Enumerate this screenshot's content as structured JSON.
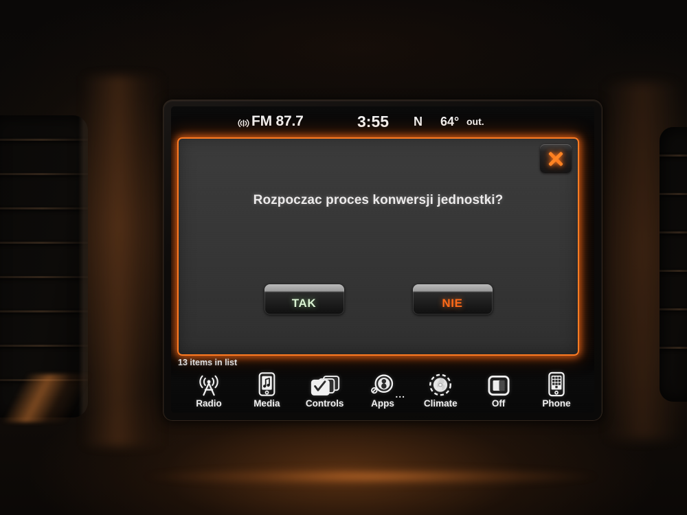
{
  "status_bar": {
    "source_icon": "broadcast-icon",
    "band": "FM 87.7",
    "clock": "3:55",
    "gear": "N",
    "temperature": "64°",
    "temperature_suffix": "out."
  },
  "dialog": {
    "message": "Rozpoczac proces konwersji jednostki?",
    "close_icon": "close-x-icon",
    "buttons": [
      {
        "label": "TAK",
        "role": "confirm",
        "color": "#d9f2d2"
      },
      {
        "label": "NIE",
        "role": "cancel",
        "color": "#ff6a18"
      }
    ]
  },
  "list_status": "13 items in list",
  "nav_bar": {
    "items": [
      {
        "label": "Radio",
        "icon": "radio-tower-icon"
      },
      {
        "label": "Media",
        "icon": "media-phone-note-icon"
      },
      {
        "label": "Controls",
        "icon": "controls-cards-icon"
      },
      {
        "label": "Apps",
        "icon": "apps-icon",
        "badge": "..."
      },
      {
        "label": "Climate",
        "icon": "climate-fan-dial-icon"
      },
      {
        "label": "Off",
        "icon": "screen-off-icon"
      },
      {
        "label": "Phone",
        "icon": "phone-keypad-icon"
      }
    ]
  },
  "colors": {
    "accent_orange": "#ff7b22",
    "dialog_background": "#383838",
    "screen_background": "#050505",
    "text_primary": "#f1f1f1"
  }
}
